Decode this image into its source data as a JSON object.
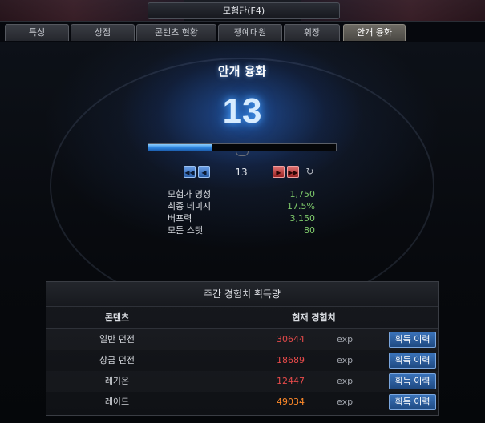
{
  "window": {
    "title": "모험단(F4)"
  },
  "tabs": [
    {
      "label": "특성",
      "active": false
    },
    {
      "label": "상점",
      "active": false
    },
    {
      "label": "콘텐츠 현황",
      "active": false
    },
    {
      "label": "쟁예대원",
      "active": false
    },
    {
      "label": "휘장",
      "active": false
    },
    {
      "label": "안개 융화",
      "active": true
    }
  ],
  "fusion": {
    "title": "안개 융화",
    "level": "13",
    "progress_fraction": 0.34,
    "nav_level": "13",
    "prev_first_icon": "◀◀",
    "prev_icon": "◀",
    "next_icon": "▶",
    "next_last_icon": "▶▶",
    "refresh_icon": "↻"
  },
  "stats": [
    {
      "label": "모험가 명성",
      "value": "1,750"
    },
    {
      "label": "최종 데미지",
      "value": "17.5%"
    },
    {
      "label": "버프력",
      "value": "3,150"
    },
    {
      "label": "모든 스탯",
      "value": "80"
    }
  ],
  "exp_panel": {
    "title": "주간 경험치 획득량",
    "col_content": "콘텐츠",
    "col_exp": "현재 경험치",
    "rows": [
      {
        "name": "일반 던전",
        "value": "30644",
        "unit": "exp",
        "button": "획득 이력"
      },
      {
        "name": "상급 던전",
        "value": "18689",
        "unit": "exp",
        "button": "획득 이력"
      },
      {
        "name": "레기온",
        "value": "12447",
        "unit": "exp",
        "button": "획득 이력"
      },
      {
        "name": "레이드",
        "value": "49034",
        "unit": "exp",
        "button": "획득 이력"
      }
    ]
  },
  "colors": {
    "accent_blue": "#2e86e0",
    "stat_green": "#7ec96b",
    "exp_red": "#e64a4a",
    "exp_orange": "#ff8a2a"
  }
}
